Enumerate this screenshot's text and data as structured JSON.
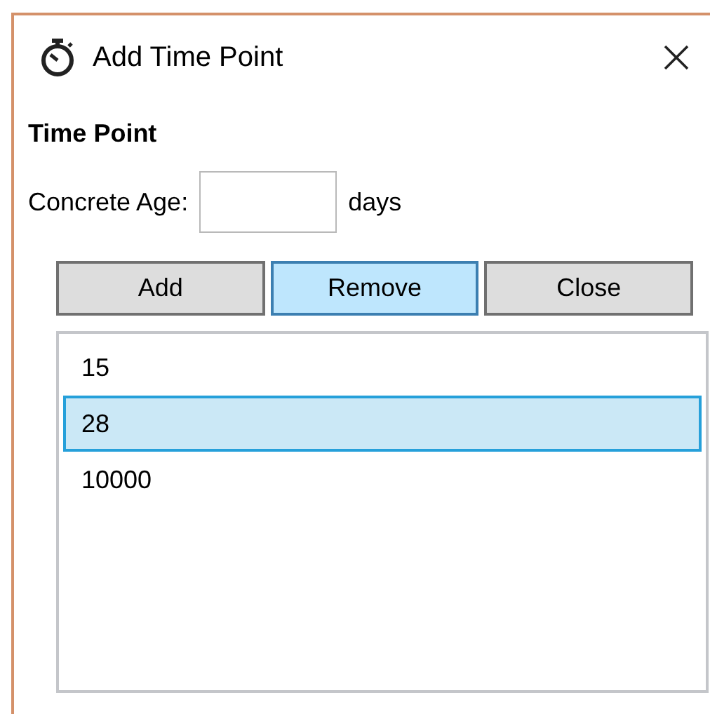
{
  "window": {
    "title": "Add Time Point"
  },
  "group_title": "Time Point",
  "concrete_age": {
    "label": "Concrete Age:",
    "unit": "days"
  },
  "buttons": [
    {
      "label": "Add",
      "hovered": false
    },
    {
      "label": "Remove",
      "hovered": true
    },
    {
      "label": "Close",
      "hovered": false
    }
  ],
  "list": [
    {
      "text": "15",
      "selected": false
    },
    {
      "text": "28",
      "selected": true
    },
    {
      "text": "10000",
      "selected": false
    }
  ]
}
